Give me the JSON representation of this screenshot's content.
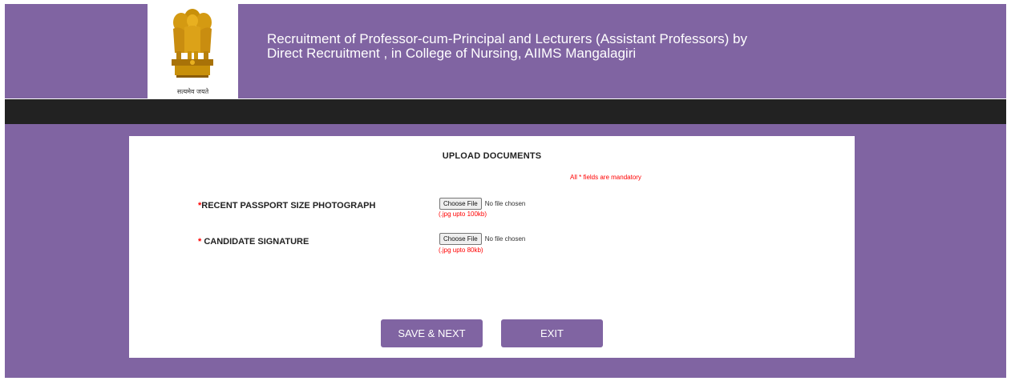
{
  "header": {
    "title_line1": "Recruitment of Professor-cum-Principal and Lecturers (Assistant Professors) by",
    "title_line2": "Direct Recruitment , in College of Nursing, AIIMS Mangalagiri",
    "emblem_motto": "सत्यमेव जयते"
  },
  "form": {
    "heading": "UPLOAD DOCUMENTS",
    "mandatory_note": "All * fields are mandatory",
    "rows": [
      {
        "star": "*",
        "label": "RECENT PASSPORT SIZE PHOTOGRAPH",
        "button": "Choose File",
        "status": "No file chosen",
        "hint": "(.jpg upto 100kb)"
      },
      {
        "star": "* ",
        "label": "CANDIDATE SIGNATURE",
        "button": "Choose File",
        "status": "No file chosen",
        "hint": "(.jpg upto 80kb)"
      }
    ]
  },
  "buttons": {
    "save_next": "SAVE & NEXT",
    "exit": "EXIT"
  },
  "colors": {
    "brand_purple": "#8064a2",
    "dark_band": "#222222",
    "required_red": "#ff0000"
  },
  "icons": {
    "emblem": "national-emblem-icon"
  }
}
